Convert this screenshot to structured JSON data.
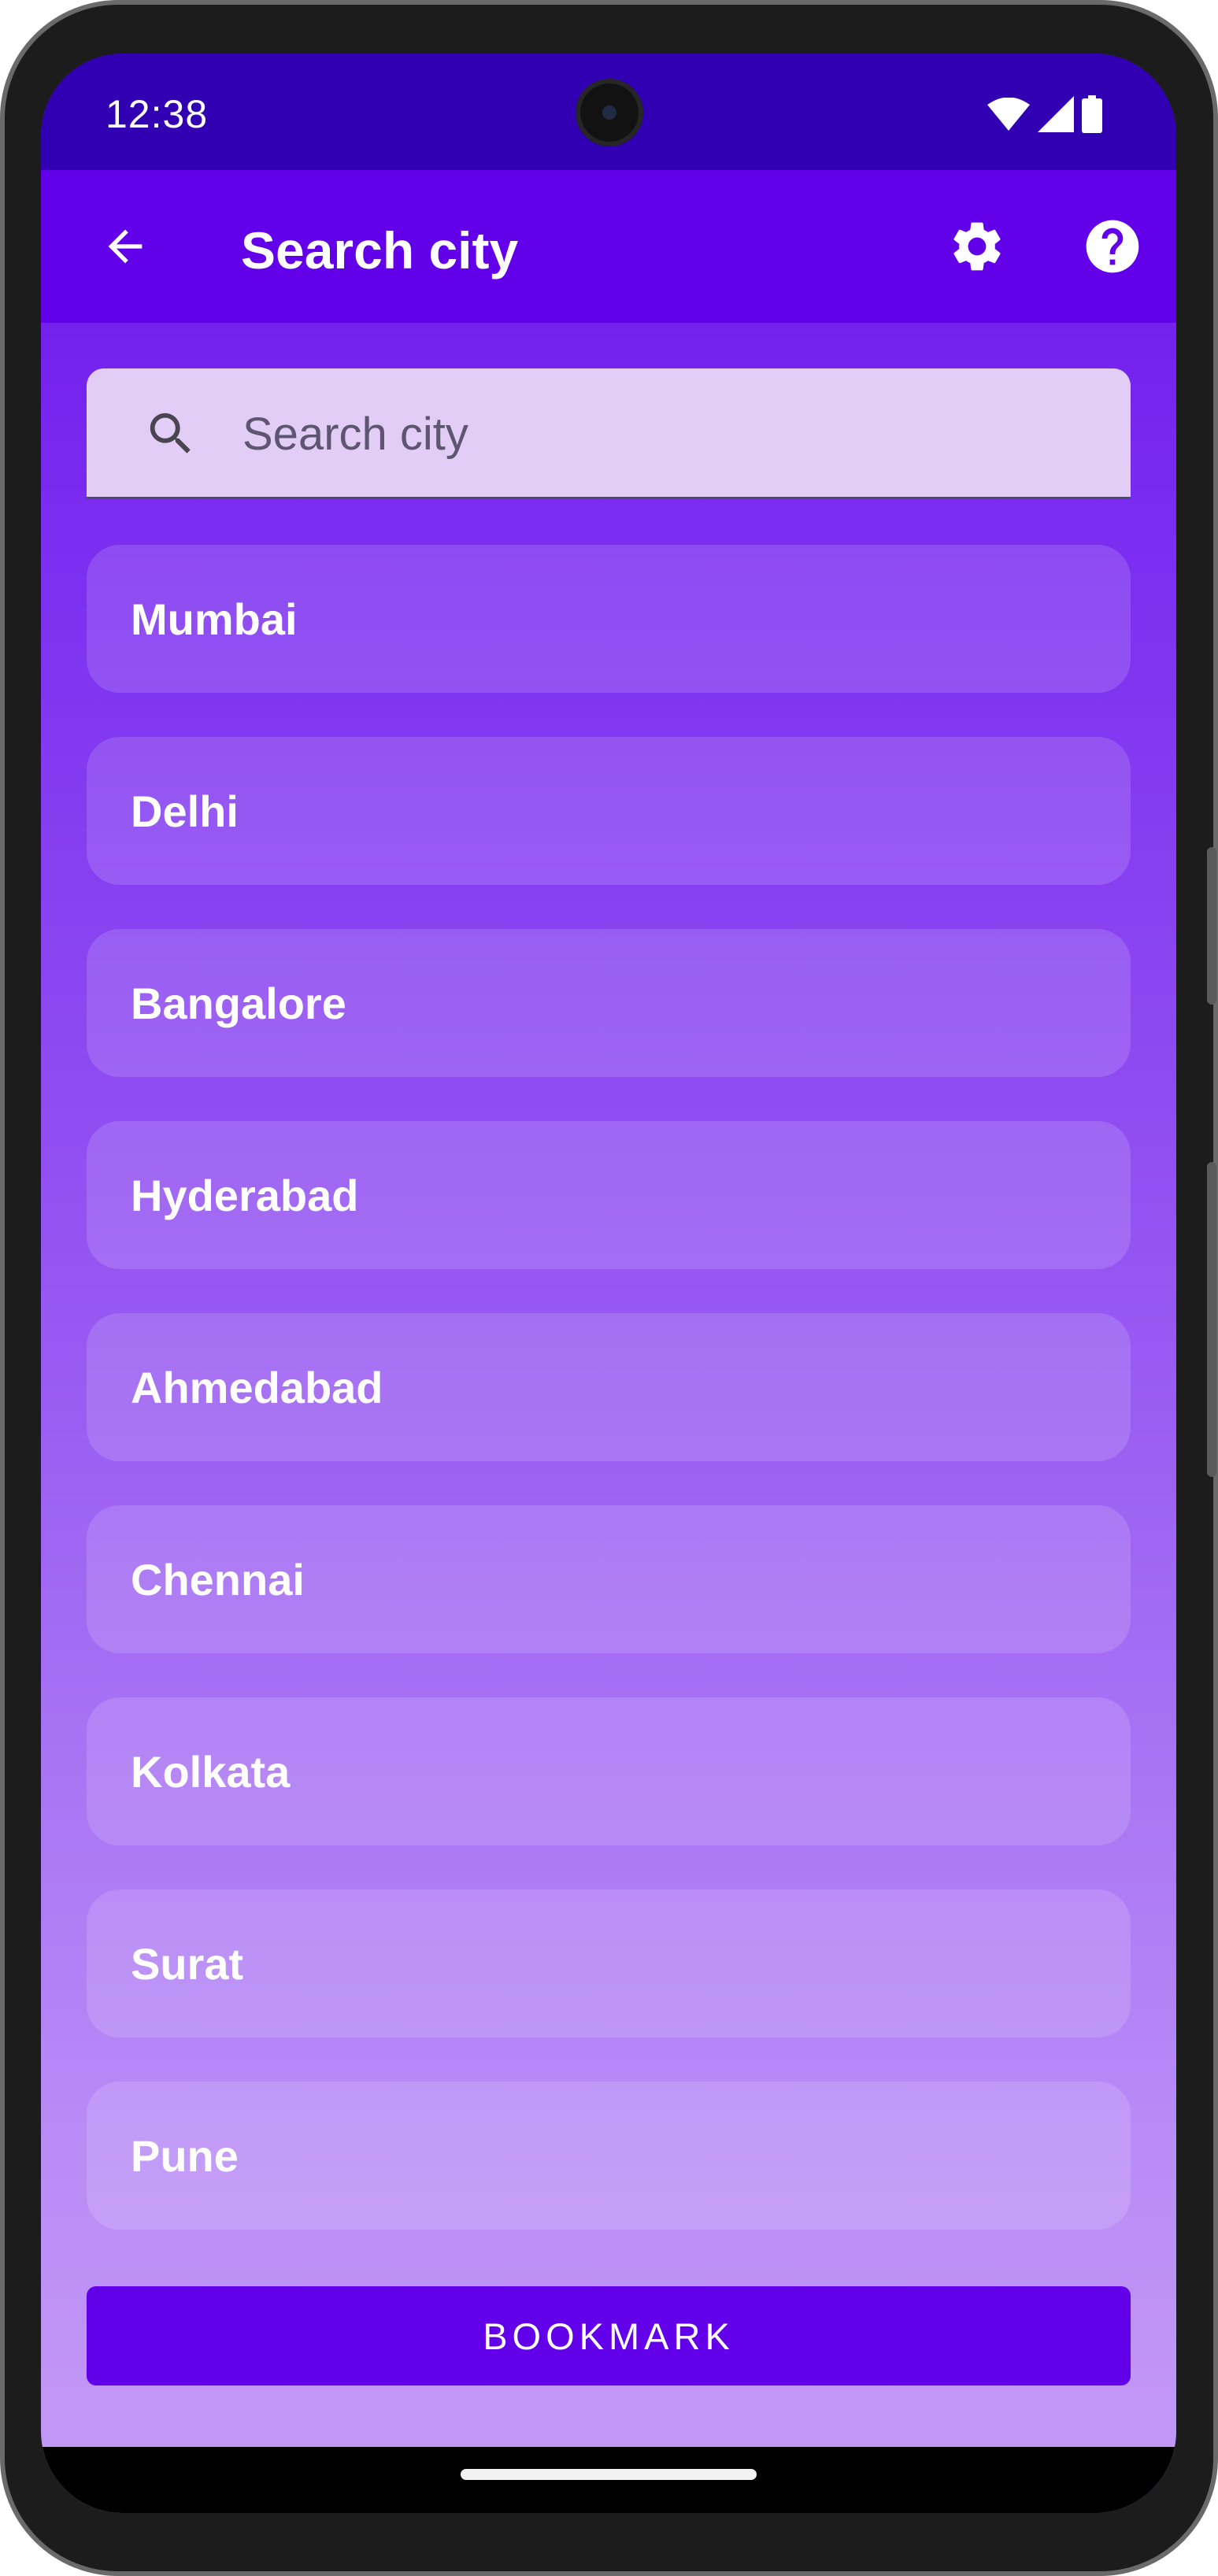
{
  "status_bar": {
    "time": "12:38",
    "icons": [
      "wifi-icon",
      "cellular-signal-icon",
      "battery-icon"
    ]
  },
  "app_bar": {
    "title": "Search city",
    "icons": [
      "arrow-back-icon",
      "gear-icon",
      "help-icon"
    ]
  },
  "search": {
    "placeholder": "Search city",
    "value": ""
  },
  "cities": [
    {
      "label": "Mumbai"
    },
    {
      "label": "Delhi"
    },
    {
      "label": "Bangalore"
    },
    {
      "label": "Hyderabad"
    },
    {
      "label": "Ahmedabad"
    },
    {
      "label": "Chennai"
    },
    {
      "label": "Kolkata"
    },
    {
      "label": "Surat"
    },
    {
      "label": "Pune"
    }
  ],
  "bookmark_button": {
    "label": "BOOKMARK"
  },
  "colors": {
    "status_bar": "#3100b3",
    "app_bar": "#6200ea",
    "search_field": "#e2cdf7",
    "bookmark_button": "#6200ea",
    "text_on_primary": "#ffffff"
  }
}
